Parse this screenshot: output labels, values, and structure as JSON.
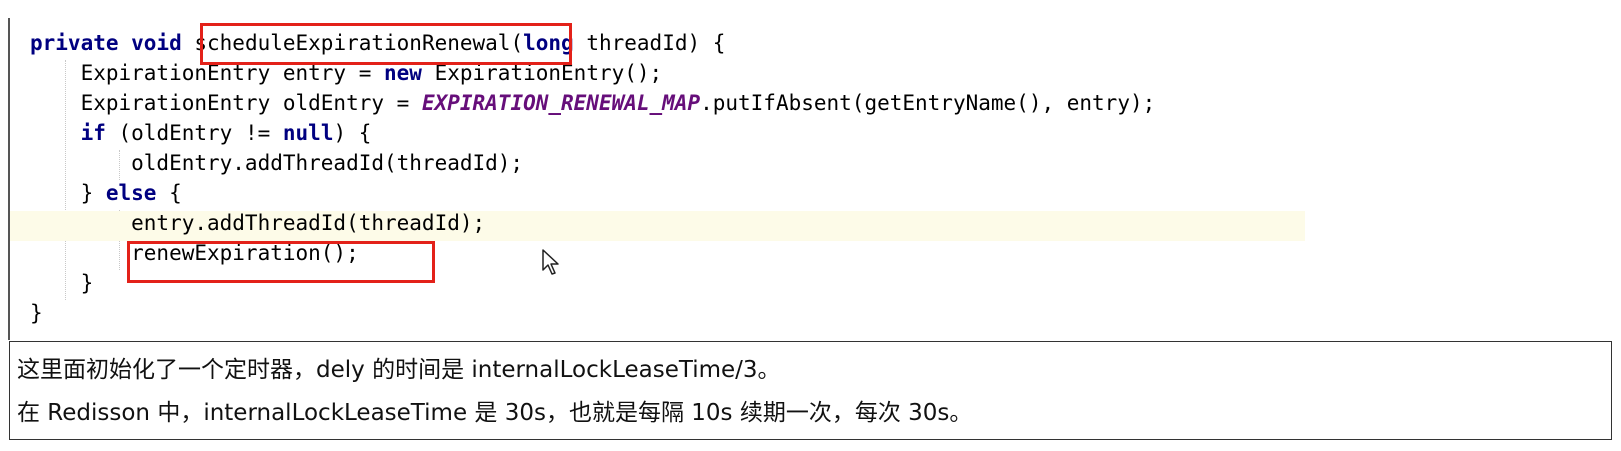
{
  "code": {
    "lines": [
      [
        {
          "t": "private void ",
          "c": "kw"
        },
        {
          "t": "scheduleExpirationRenewal"
        },
        {
          "t": "("
        },
        {
          "t": "long",
          "c": "kw"
        },
        {
          "t": " threadId) {"
        }
      ],
      [
        {
          "t": "    ExpirationEntry entry = "
        },
        {
          "t": "new",
          "c": "kw"
        },
        {
          "t": " ExpirationEntry();"
        }
      ],
      [
        {
          "t": "    ExpirationEntry oldEntry = "
        },
        {
          "t": "EXPIRATION_RENEWAL_MAP",
          "c": "field"
        },
        {
          "t": ".putIfAbsent(getEntryName(), entry);"
        }
      ],
      [
        {
          "t": "    "
        },
        {
          "t": "if",
          "c": "kw"
        },
        {
          "t": " (oldEntry != "
        },
        {
          "t": "null",
          "c": "kw"
        },
        {
          "t": ") {"
        }
      ],
      [
        {
          "t": "        oldEntry.addThreadId(threadId);"
        }
      ],
      [
        {
          "t": "    } "
        },
        {
          "t": "else",
          "c": "kw"
        },
        {
          "t": " {"
        }
      ],
      [
        {
          "t": "        entry.addThreadId(threadId);"
        }
      ],
      [
        {
          "t": "        renewExpiration();"
        }
      ],
      [
        {
          "t": "    }"
        }
      ],
      [
        {
          "t": "}"
        }
      ]
    ]
  },
  "notes": {
    "line1": "这里面初始化了一个定时器，dely 的时间是 internalLockLeaseTime/3。",
    "line2": "在 Redisson 中，internalLockLeaseTime 是 30s，也就是每隔 10s 续期一次，每次 30s。"
  },
  "colors": {
    "highlight_box": "#e32119",
    "keyword": "#000080",
    "static_field": "#660e7a",
    "current_line": "#fdfbe8"
  }
}
